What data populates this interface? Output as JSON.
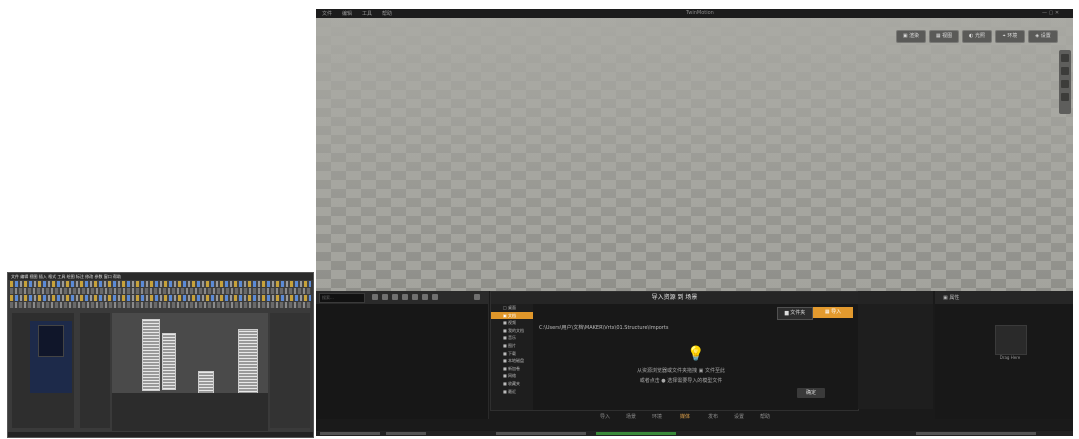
{
  "app": {
    "title": "TwinMotion",
    "menu": [
      "文件",
      "编辑",
      "工具",
      "帮助"
    ],
    "window_controls": "— ▢ ✕",
    "viewport_buttons": [
      "▣ 渲染",
      "▦ 视图",
      "◐ 光照",
      "⌖ 环境",
      "◈ 设置"
    ],
    "side_tools": [
      "move",
      "rotate",
      "scale",
      "snap"
    ]
  },
  "dialog": {
    "title": "导入资源 到 场景",
    "tree_items": [
      "□ 桌面",
      "▣ 文档",
      "■ 视频",
      "■ 我的文档",
      "■ 音乐",
      "■ 图片",
      "■ 下载",
      "■ 本地磁盘",
      "■ 新加卷",
      "■ 网络",
      "■ 收藏夹",
      "■ 最近"
    ],
    "active_index": 1,
    "path": "C:\\Users\\用户\\文档\\MAKER\\Vrtx\\01.Structure\\Imports",
    "folder_button": "▆ 文件夹",
    "import_button": "▦ 导入",
    "hint_line1": "从资源浏览器或文件夹拖拽 ▣ 文件至此",
    "hint_line2": "或者点击 ● 选择需要导入的模型文件",
    "confirm_button": "确定"
  },
  "left_dock": {
    "search_placeholder": "搜索..."
  },
  "right_dock": {
    "title": "▣ 属性",
    "thumb_label": "Drag Here"
  },
  "modebar": [
    "导入",
    "场景",
    "环境",
    "媒体",
    "发布",
    "设置",
    "帮助"
  ],
  "mode_active_index": 3,
  "cad": {
    "menubar": "文件 编辑 视图 插入 格式 工具 绘图 标注 修改 参数 窗口 帮助"
  }
}
